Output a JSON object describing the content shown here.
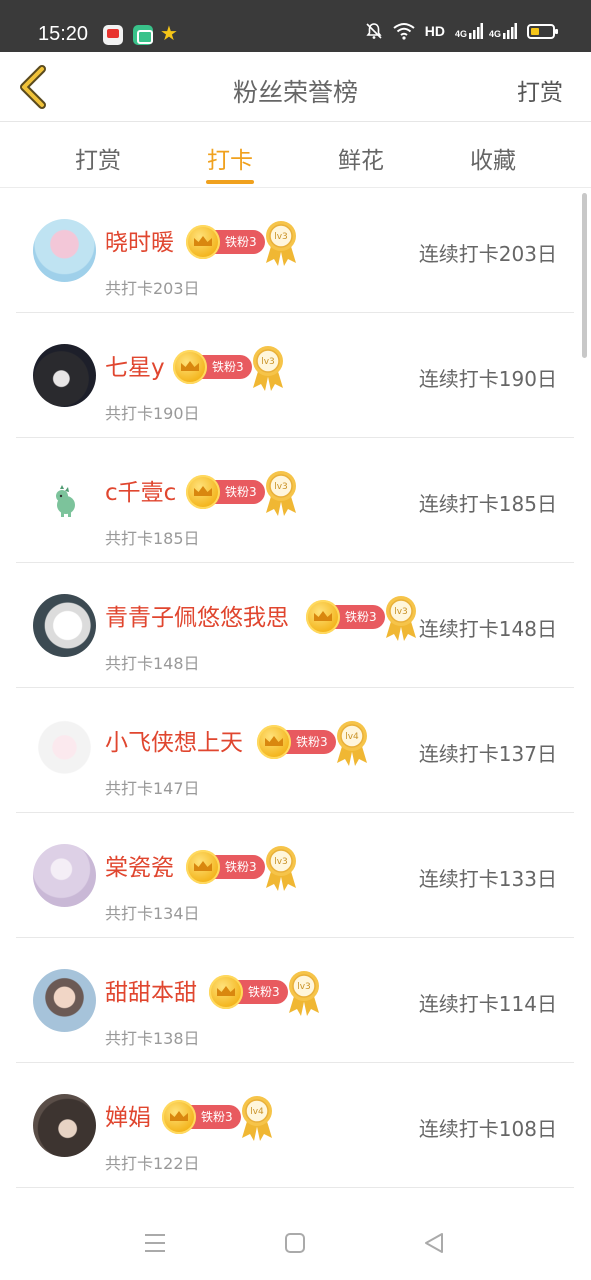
{
  "status_bar": {
    "time": "15:20",
    "network_label": "HD",
    "signal_label_1": "4G",
    "signal_label_2": "4G",
    "icons": [
      "video-app-icon",
      "chat-app-icon",
      "star-app-icon",
      "mute-icon",
      "wifi-icon",
      "signal-icon",
      "battery-icon"
    ]
  },
  "header": {
    "title": "粉丝荣誉榜",
    "action_label": "打赏"
  },
  "tabs": [
    {
      "label": "打赏",
      "active": false
    },
    {
      "label": "打卡",
      "active": true
    },
    {
      "label": "鲜花",
      "active": false
    },
    {
      "label": "收藏",
      "active": false
    }
  ],
  "colors": {
    "accent": "#f0a11e",
    "name": "#e0462f",
    "fan_tag": "#e85a5f",
    "medal": "#f0b733"
  },
  "rows": [
    {
      "name": "晓时暖",
      "fan_level": "铁粉3",
      "medal_level": "lv3",
      "total": "共打卡203日",
      "streak": "连续打卡203日",
      "avatar": "avatar-blue"
    },
    {
      "name": "七星y",
      "fan_level": "铁粉3",
      "medal_level": "lv3",
      "total": "共打卡190日",
      "streak": "连续打卡190日",
      "avatar": "avatar-dark"
    },
    {
      "name": "c千壹c",
      "fan_level": "铁粉3",
      "medal_level": "lv3",
      "total": "共打卡185日",
      "streak": "连续打卡185日",
      "avatar": "avatar-dino"
    },
    {
      "name": "青青子佩悠悠我思",
      "fan_level": "铁粉3",
      "medal_level": "lv3",
      "total": "共打卡148日",
      "streak": "连续打卡148日",
      "avatar": "avatar-dog"
    },
    {
      "name": "小飞侠想上天",
      "fan_level": "铁粉3",
      "medal_level": "lv4",
      "total": "共打卡147日",
      "streak": "连续打卡137日",
      "avatar": "avatar-anime"
    },
    {
      "name": "棠瓷瓷",
      "fan_level": "铁粉3",
      "medal_level": "lv3",
      "total": "共打卡134日",
      "streak": "连续打卡133日",
      "avatar": "avatar-purple"
    },
    {
      "name": "甜甜本甜",
      "fan_level": "铁粉3",
      "medal_level": "lv3",
      "total": "共打卡138日",
      "streak": "连续打卡114日",
      "avatar": "avatar-boy"
    },
    {
      "name": "婵娟",
      "fan_level": "铁粉3",
      "medal_level": "lv4",
      "total": "共打卡122日",
      "streak": "连续打卡108日",
      "avatar": "avatar-hair"
    }
  ],
  "nav_bar": {
    "icons": [
      "menu-icon",
      "home-square-icon",
      "back-triangle-icon"
    ]
  }
}
